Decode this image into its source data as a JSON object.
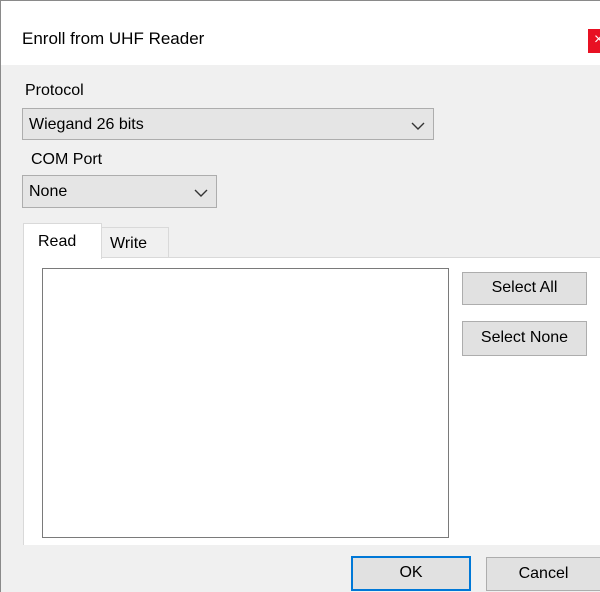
{
  "window": {
    "title": "Enroll from UHF Reader",
    "close_glyph": "×"
  },
  "protocol": {
    "label": "Protocol",
    "selected": "Wiegand 26 bits"
  },
  "com_port": {
    "label": "COM Port",
    "selected": "None"
  },
  "tabs": [
    {
      "label": "Read",
      "active": true
    },
    {
      "label": "Write",
      "active": false
    }
  ],
  "buttons": {
    "select_all": "Select All",
    "select_none": "Select None",
    "ok": "OK",
    "cancel": "Cancel"
  },
  "colors": {
    "window_bg": "#f0f0f0",
    "titlebar_bg": "#ffffff",
    "close_bg": "#e81123",
    "default_button_border": "#0078d7"
  },
  "icons": {
    "dropdown": "chevron-down-icon",
    "close": "close-icon"
  }
}
